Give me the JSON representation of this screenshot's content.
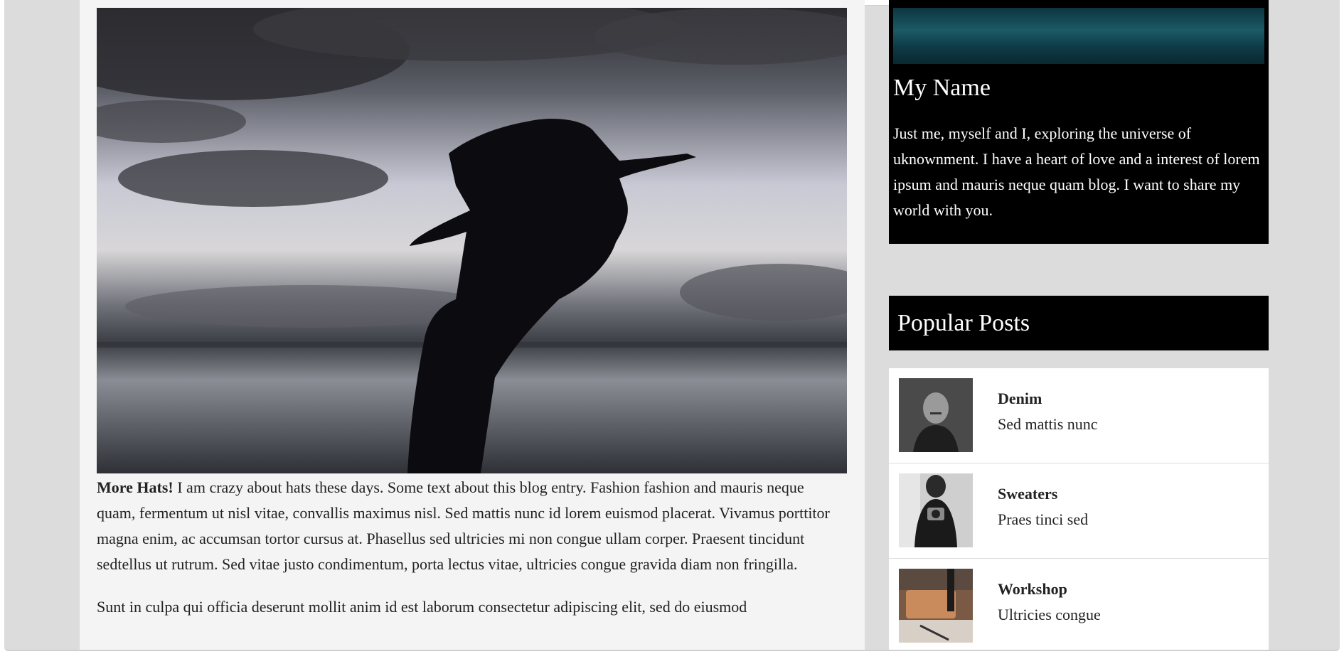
{
  "post": {
    "lead": "More Hats!",
    "paragraph1": " I am crazy about hats these days. Some text about this blog entry. Fashion fashion and mauris neque quam, fermentum ut nisl vitae, convallis maximus nisl. Sed mattis nunc id lorem euismod placerat. Vivamus porttitor magna enim, ac accumsan tortor cursus at. Phasellus sed ultricies mi non congue ullam corper. Praesent tincidunt sedtellus ut rutrum. Sed vitae justo condimentum, porta lectus vitae, ultricies congue gravida diam non fringilla.",
    "paragraph2": "Sunt in culpa qui officia deserunt mollit anim id est laborum consectetur adipiscing elit, sed do eiusmod"
  },
  "about": {
    "name": "My Name",
    "bio": "Just me, myself and I, exploring the universe of uknownment. I have a heart of love and a interest of lorem ipsum and mauris neque quam blog. I want to share my world with you."
  },
  "popular": {
    "title": "Popular Posts",
    "items": [
      {
        "title": "Denim",
        "subtitle": "Sed mattis nunc"
      },
      {
        "title": "Sweaters",
        "subtitle": "Praes tinci sed"
      },
      {
        "title": "Workshop",
        "subtitle": "Ultricies congue"
      }
    ]
  },
  "colors": {
    "page_background": "#dcdcdc",
    "content_background": "#f4f4f4",
    "card_background": "#000000",
    "card_text": "#ffffff",
    "body_text": "#222222"
  },
  "icons": {
    "hero_image": "woman-in-hat-silhouette-sunset",
    "about_image": "teal-texture",
    "thumb_denim": "man-portrait-bw",
    "thumb_sweaters": "person-with-camera",
    "thumb_workshop": "leather-workshop-tools"
  }
}
